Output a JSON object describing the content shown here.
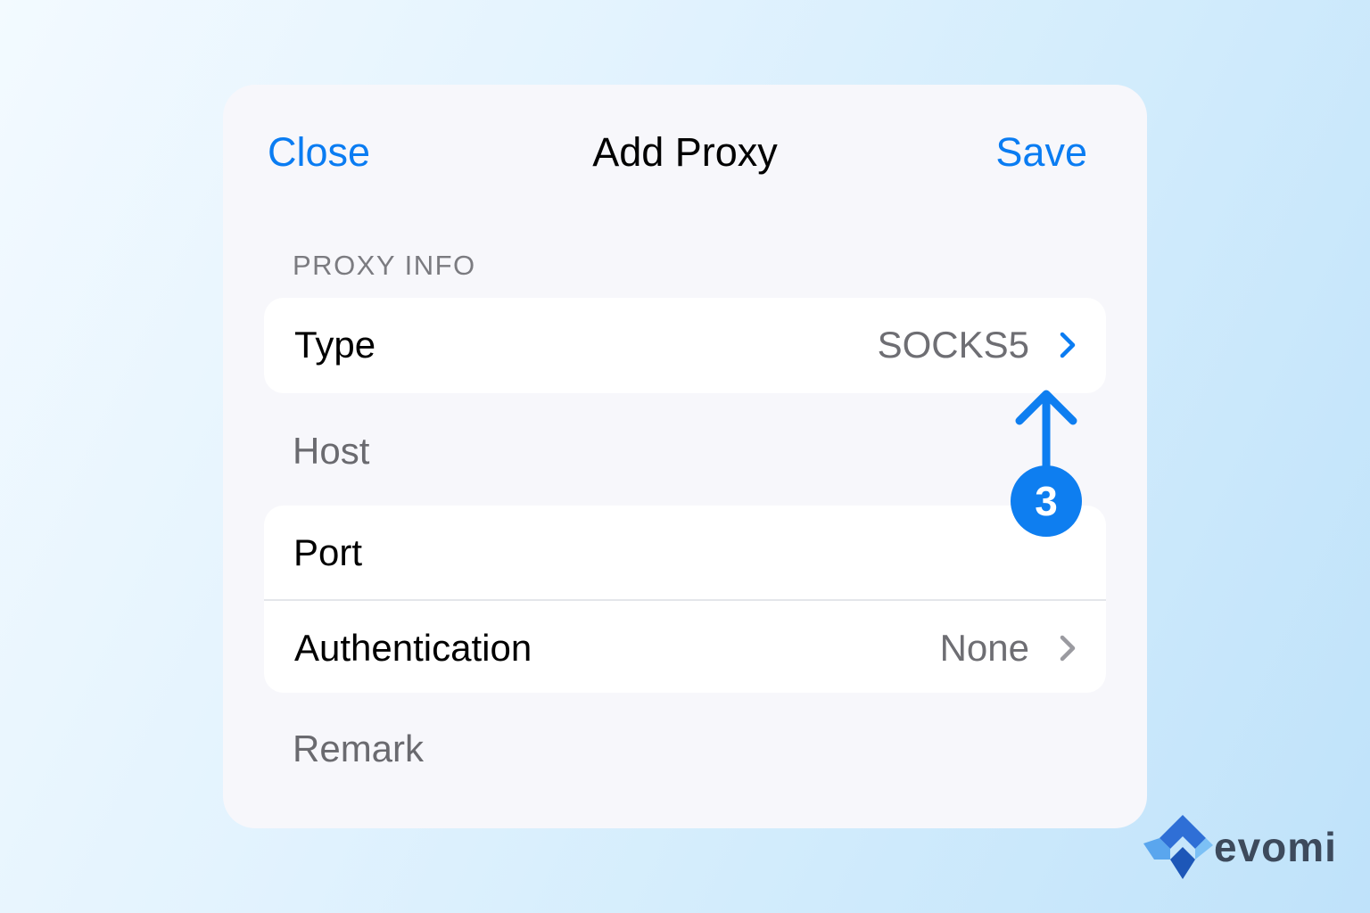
{
  "nav": {
    "close_label": "Close",
    "title": "Add Proxy",
    "save_label": "Save"
  },
  "section": {
    "header": "PROXY INFO"
  },
  "rows": {
    "type": {
      "label": "Type",
      "value": "SOCKS5"
    },
    "host": {
      "placeholder": "Host"
    },
    "port": {
      "label": "Port"
    },
    "authentication": {
      "label": "Authentication",
      "value": "None"
    },
    "remark": {
      "placeholder": "Remark"
    }
  },
  "annotation": {
    "step_number": "3"
  },
  "brand": {
    "name": "evomi"
  },
  "colors": {
    "accent": "#0a7cf2",
    "badge": "#0e7ef0",
    "secondary_text": "#6e6e73",
    "card_background": "#f7f7fb"
  },
  "icons": {
    "type_chevron": "chevron-right-icon",
    "authentication_chevron": "chevron-right-icon",
    "callout_arrow": "arrow-up-icon",
    "logo": "evomi-logo-icon"
  }
}
